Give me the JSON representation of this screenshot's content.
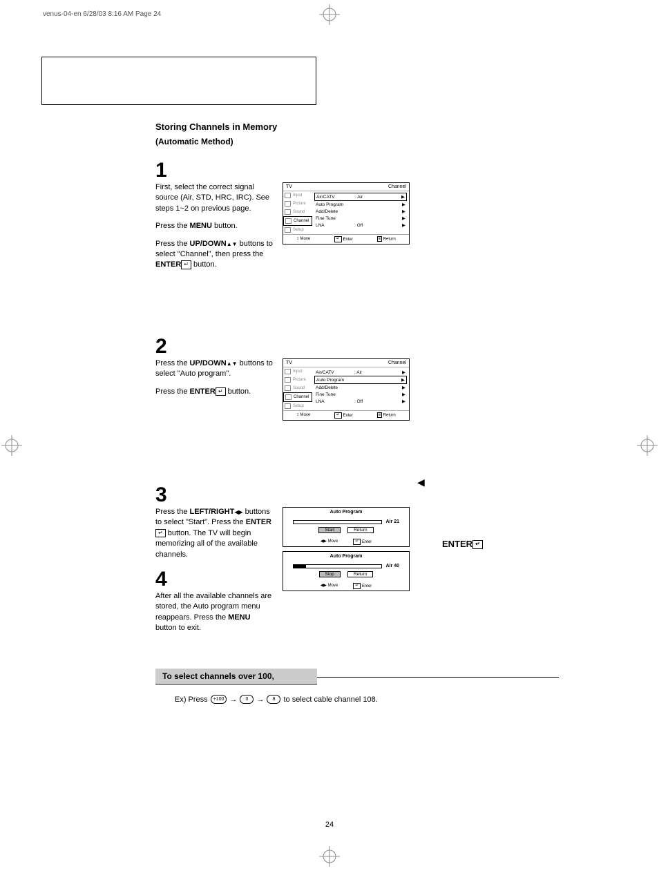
{
  "print_header": "venus-04-en  6/28/03 8:16 AM  Page 24",
  "heading": "Storing Channels in Memory",
  "subheading": "(Automatic Method)",
  "page_number": "24",
  "step1": {
    "num": "1",
    "p1": "First, select the correct signal source (Air, STD, HRC, IRC). See steps 1~2 on previous page.",
    "p2a": "Press the ",
    "p2b": "MENU",
    "p2c": " button.",
    "p3a": "Press the ",
    "p3b": "UP/DOWN",
    "p3c": " buttons to select \"Channel\", then press the ",
    "p3d": "ENTER",
    "p3e": " button."
  },
  "step2": {
    "num": "2",
    "p1a": "Press the ",
    "p1b": "UP/DOWN",
    "p1c": " buttons to select \"Auto program\".",
    "p2a": "Press the ",
    "p2b": "ENTER",
    "p2c": " button."
  },
  "step3": {
    "num": "3",
    "p1a": "Press the ",
    "p1b": "LEFT/RIGHT",
    "p1c": " buttons to select \"Start\". Press the ",
    "p1d": "ENTER",
    "p1e": " button. The TV will begin  memorizing all of the available channels."
  },
  "step4": {
    "num": "4",
    "p1a": "After all the available channels are stored, the Auto program menu reappears. Press the ",
    "p1b": "MENU",
    "p1c": " button to exit."
  },
  "osd": {
    "tv": "TV",
    "section_label": "Channel",
    "side": [
      "Input",
      "Picture",
      "Sound",
      "Channel",
      "Setup"
    ],
    "rows": [
      {
        "label": "Air/CATV",
        "val": ":   Air"
      },
      {
        "label": "Auto Program",
        "val": ""
      },
      {
        "label": "Add/Delete",
        "val": ""
      },
      {
        "label": "Fine Tune",
        "val": ""
      },
      {
        "label": "LNA",
        "val": ":   Off"
      }
    ],
    "footer": {
      "move": "Move",
      "enter": "Enter",
      "return": "Return"
    }
  },
  "auto1": {
    "title": "Auto Program",
    "channel": "Air 21",
    "btn_start": "Start",
    "btn_return": "Return",
    "move": "Move",
    "enter": "Enter"
  },
  "auto2": {
    "title": "Auto Program",
    "channel": "Air 40",
    "btn_stop": "Stop",
    "btn_return": "Return",
    "move": "Move",
    "enter": "Enter"
  },
  "side_enter": "ENTER",
  "select": {
    "title": "To select channels over 100,",
    "ex_prefix": "Ex) Press ",
    "pill1": "+100",
    "pill2": "0",
    "pill3": "8",
    "ex_suffix": " to select cable channel 108."
  }
}
